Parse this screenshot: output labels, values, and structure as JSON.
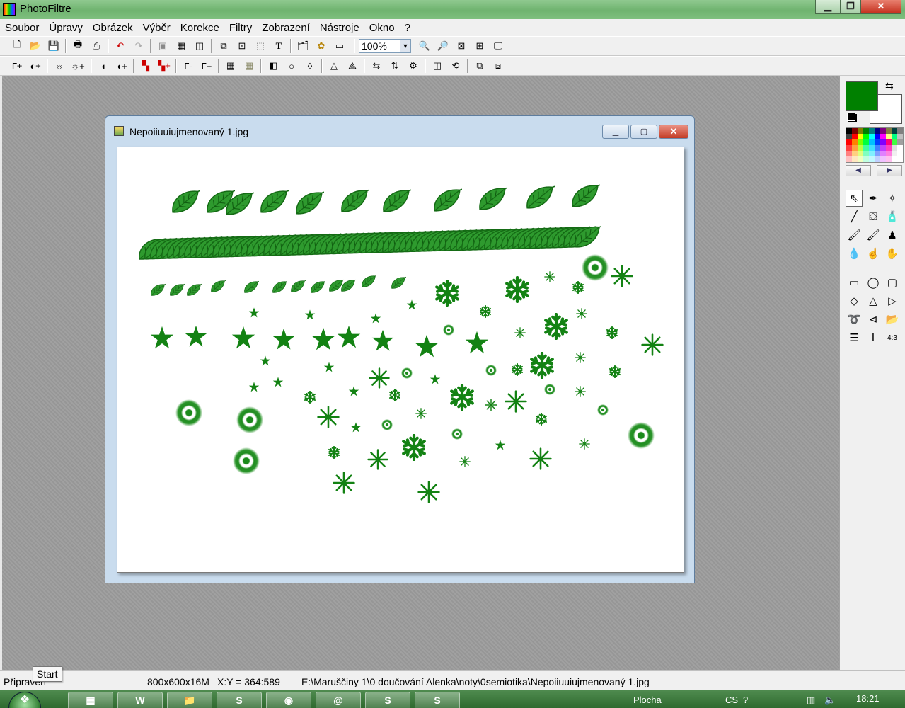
{
  "app": {
    "title": "PhotoFiltre"
  },
  "menu": [
    "Soubor",
    "Úpravy",
    "Obrázek",
    "Výběr",
    "Korekce",
    "Filtry",
    "Zobrazení",
    "Nástroje",
    "Okno",
    "?"
  ],
  "toolbar": {
    "zoom_value": "100%"
  },
  "document": {
    "title": "Nepoiiuuiujmenovaný 1.jpg"
  },
  "colors": {
    "foreground": "#008000",
    "background": "#ffffff",
    "palette": [
      "#000000",
      "#800000",
      "#808000",
      "#008000",
      "#008080",
      "#000080",
      "#800080",
      "#808040",
      "#004040",
      "#808080",
      "#404040",
      "#ff0000",
      "#ffff00",
      "#00ff00",
      "#00ffff",
      "#0000ff",
      "#ff00ff",
      "#ffff80",
      "#00ff80",
      "#c0c0c0",
      "#ff0000",
      "#ff8000",
      "#80ff00",
      "#00ff40",
      "#00c0ff",
      "#0040ff",
      "#8000ff",
      "#ff0080",
      "#40ff40",
      "#a0a0a0",
      "#ff4040",
      "#ffa040",
      "#c0ff40",
      "#40ffa0",
      "#40e0ff",
      "#4080ff",
      "#c040ff",
      "#ff40c0",
      "#e0e0e0",
      "#ffffff",
      "#ff8080",
      "#ffd080",
      "#e0ff80",
      "#80ffc0",
      "#80f0ff",
      "#80a0ff",
      "#e080ff",
      "#ff80e0",
      "#f0f0f0",
      "#ffffff",
      "#ffc0c0",
      "#ffe8c0",
      "#f0ffc0",
      "#c0ffe0",
      "#c0f8ff",
      "#c0d0ff",
      "#f0c0ff",
      "#ffc0f0",
      "#ffffff",
      "#ffffff"
    ]
  },
  "status": {
    "ready": "Připraven",
    "size": "800x600x16M",
    "coords": "X:Y = 364:589",
    "path": "E:\\Maruščiny 1\\0 doučování Alenka\\noty\\0semiotika\\Nepoiiuuiujmenovaný 1.jpg"
  },
  "tooltip": "Start",
  "taskbar": {
    "desktop_label": "Plocha",
    "lang": "CS",
    "time": "18:21"
  }
}
